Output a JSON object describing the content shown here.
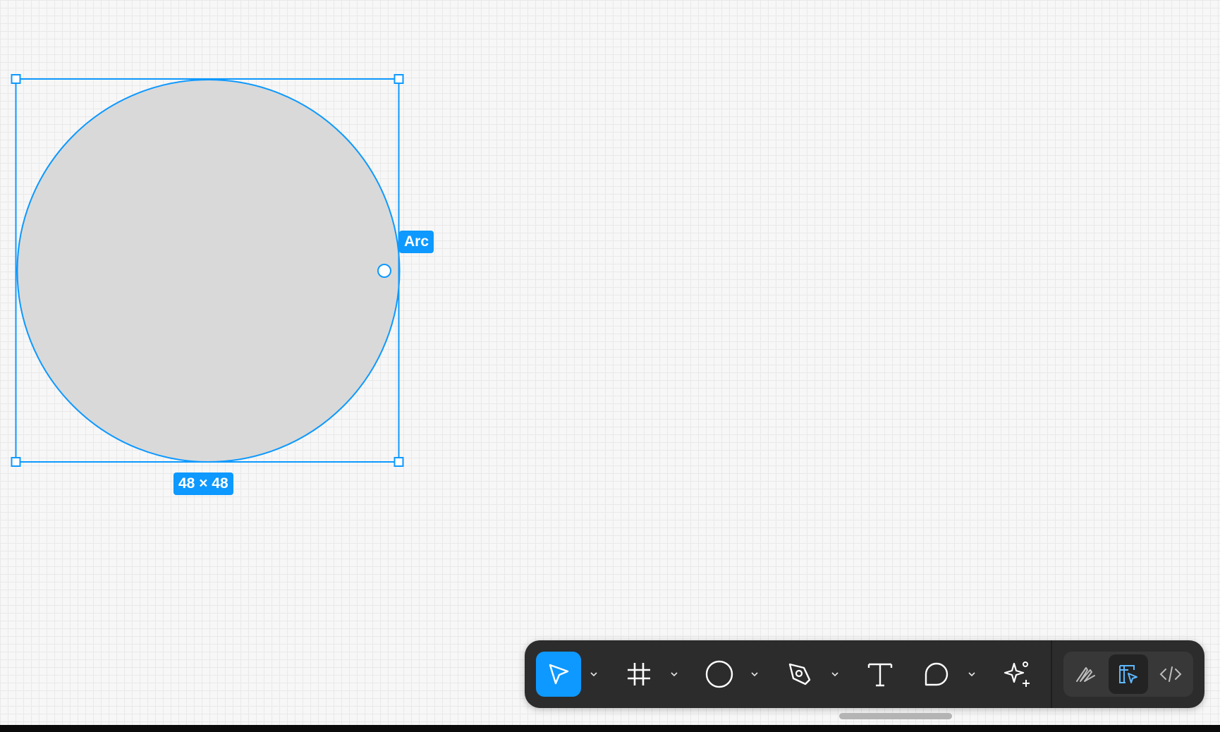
{
  "canvas": {
    "selection": {
      "shape_label": "Arc",
      "size_label": "48 × 48"
    }
  },
  "colors": {
    "accent": "#0d99ff",
    "toolbar_bg": "#2c2c2c",
    "shape_fill": "#d9d9d9"
  },
  "toolbar": {
    "tools": [
      {
        "icon": "move-cursor-icon",
        "active": true,
        "has_menu": true
      },
      {
        "icon": "frame-hash-icon",
        "active": false,
        "has_menu": true
      },
      {
        "icon": "ellipse-icon",
        "active": false,
        "has_menu": true
      },
      {
        "icon": "pen-tool-icon",
        "active": false,
        "has_menu": true
      },
      {
        "icon": "text-T-icon",
        "active": false,
        "has_menu": false
      },
      {
        "icon": "comment-bubble-icon",
        "active": false,
        "has_menu": true
      },
      {
        "icon": "ai-sparkle-icon",
        "active": false,
        "has_menu": false
      }
    ],
    "modes": [
      {
        "icon": "draw-mode-icon",
        "selected": false
      },
      {
        "icon": "design-mode-icon",
        "selected": true
      },
      {
        "icon": "dev-mode-code-icon",
        "selected": false
      }
    ]
  }
}
